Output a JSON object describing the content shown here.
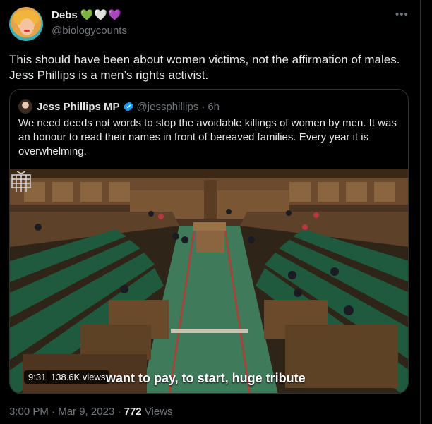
{
  "author": {
    "display_name": "Debs",
    "emoji": [
      "💚",
      "🤍",
      "💜"
    ],
    "handle": "@biologycounts"
  },
  "more_icon": "•••",
  "tweet": {
    "text": "This should have been about women victims, not the affirmation of males. Jess Phillips is a men’s rights activist."
  },
  "quoted": {
    "display_name": "Jess Phillips MP",
    "handle": "@jessphillips",
    "separator": "·",
    "age": "6h",
    "text": "We need deeds not words to stop the avoidable killings of women by men. It was an honour to read their names in front of bereaved families. Every year it is overwhelming.",
    "video": {
      "duration": "9:31",
      "views": "138.6K views",
      "caption": "want to pay, to start, huge tribute"
    }
  },
  "footer": {
    "time": "3:00 PM",
    "sep1": "·",
    "date": "Mar 9, 2023",
    "sep2": "·",
    "views_count": "772",
    "views_label": "Views"
  },
  "colors": {
    "background": "#000000",
    "text": "#e7e9ea",
    "secondary": "#71767b",
    "border": "#2f3336",
    "verified": "#1d9bf0"
  }
}
